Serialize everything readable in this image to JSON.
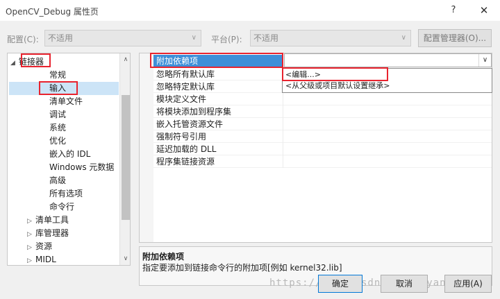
{
  "window": {
    "title": "OpenCV_Debug 属性页",
    "help": "?",
    "close": "✕"
  },
  "toolbar": {
    "config_label": "配置(C):",
    "config_value": "不适用",
    "platform_label": "平台(P):",
    "platform_value": "不适用",
    "config_manager": "配置管理器(O)..."
  },
  "tree": {
    "items": [
      {
        "label": "链接器",
        "toggle": "◢"
      },
      {
        "label": "常规"
      },
      {
        "label": "输入"
      },
      {
        "label": "清单文件"
      },
      {
        "label": "调试"
      },
      {
        "label": "系统"
      },
      {
        "label": "优化"
      },
      {
        "label": "嵌入的 IDL"
      },
      {
        "label": "Windows 元数据"
      },
      {
        "label": "高级"
      },
      {
        "label": "所有选项"
      },
      {
        "label": "命令行"
      },
      {
        "label": "清单工具",
        "toggle": "▷"
      },
      {
        "label": "库管理器",
        "toggle": "▷"
      },
      {
        "label": "资源",
        "toggle": "▷"
      },
      {
        "label": "MIDL",
        "toggle": "▷"
      }
    ],
    "selected": "输入",
    "scroll_up": "∧",
    "scroll_down": "∨"
  },
  "properties": {
    "rows": [
      {
        "name": "附加依赖项",
        "selected": true
      },
      {
        "name": "忽略所有默认库"
      },
      {
        "name": "忽略特定默认库"
      },
      {
        "name": "模块定义文件"
      },
      {
        "name": "将模块添加到程序集"
      },
      {
        "name": "嵌入托管资源文件"
      },
      {
        "name": "强制符号引用"
      },
      {
        "name": "延迟加载的 DLL"
      },
      {
        "name": "程序集链接资源"
      }
    ],
    "dropdown_arrow": "∨",
    "dropdown_options": [
      "<编辑...>",
      "<从父级或项目默认设置继承>"
    ]
  },
  "description": {
    "title": "附加依赖项",
    "text": "指定要添加到链接命令行的附加项[例如 kernel32.lib]"
  },
  "buttons": {
    "ok": "确定",
    "cancel": "取消",
    "apply": "应用(A)"
  },
  "watermark": "https://blog.csdn.net/bryan_swang",
  "colors": {
    "highlight": "#e8232e",
    "selection": "#3e8fd8",
    "tree_selection": "#cce4f7"
  }
}
